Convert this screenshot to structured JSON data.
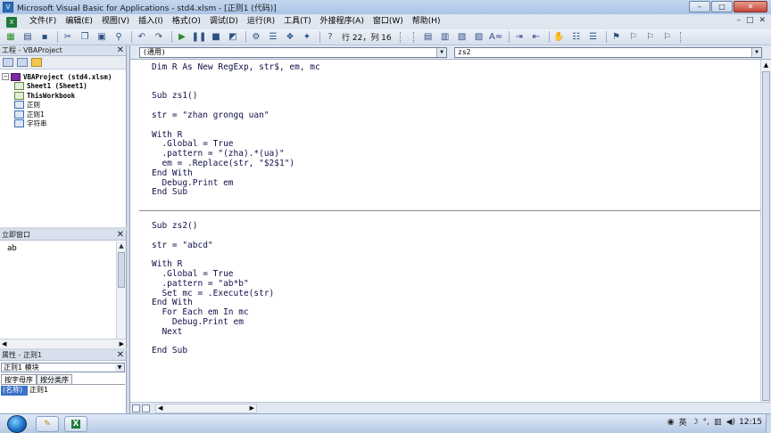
{
  "window": {
    "title": "Microsoft Visual Basic for Applications - std4.xlsm - [正则1 (代码)]",
    "buttons": [
      "–",
      "□",
      "✕"
    ]
  },
  "menu": {
    "items": [
      "文件(F)",
      "编辑(E)",
      "视图(V)",
      "插入(I)",
      "格式(O)",
      "调试(D)",
      "运行(R)",
      "工具(T)",
      "外接程序(A)",
      "窗口(W)",
      "帮助(H)"
    ],
    "mdi_buttons": [
      "–",
      "□",
      "✕"
    ]
  },
  "toolbar": {
    "position_text": "行 22，列 16"
  },
  "project_pane": {
    "title": "工程 - VBAProject",
    "tree": [
      {
        "label": "VBAProject (std4.xlsm)",
        "level": 0,
        "icon": "project-icon"
      },
      {
        "label": "Sheet1 (Sheet1)",
        "level": 1,
        "icon": "sheet-icon"
      },
      {
        "label": "ThisWorkbook",
        "level": 1,
        "icon": "sheet-icon"
      },
      {
        "label": "正则",
        "level": 1,
        "icon": "module-icon"
      },
      {
        "label": "正则1",
        "level": 1,
        "icon": "module-icon"
      },
      {
        "label": "字符串",
        "level": 1,
        "icon": "module-icon"
      }
    ]
  },
  "immediate_pane": {
    "title": "立即窗口",
    "content": "ab"
  },
  "properties_pane": {
    "title": "属性 - 正则1",
    "object_select": "正则1 模块",
    "tabs": [
      "按字母序",
      "按分类序"
    ],
    "name_key": "(名称)",
    "name_value": "正则1"
  },
  "code_window": {
    "object_combo": "(通用)",
    "procedure_combo": "zs2",
    "block1": [
      "Dim R As New RegExp, str$, em, mc",
      "",
      "",
      "Sub zs1()",
      "",
      "str = \"zhan grongq uan\"",
      "",
      "With R",
      "  .Global = True",
      "  .pattern = \"(zha).*(ua)\"",
      "  em = .Replace(str, \"$2$1\")",
      "End With",
      "  Debug.Print em",
      "End Sub"
    ],
    "block2": [
      "Sub zs2()",
      "",
      "str = \"abcd\"",
      "",
      "With R",
      "  .Global = True",
      "  .pattern = \"ab*b\"",
      "  Set mc = .Execute(str)",
      "End With",
      "  For Each em In mc",
      "    Debug.Print em",
      "  Next",
      "",
      "End Sub"
    ]
  },
  "taskbar": {
    "tray_ime": "英",
    "clock": "12:15"
  },
  "colors": {
    "code_text": "#10104a",
    "title_bar": "#b7cdea",
    "selected_property": "#3a70c8"
  }
}
